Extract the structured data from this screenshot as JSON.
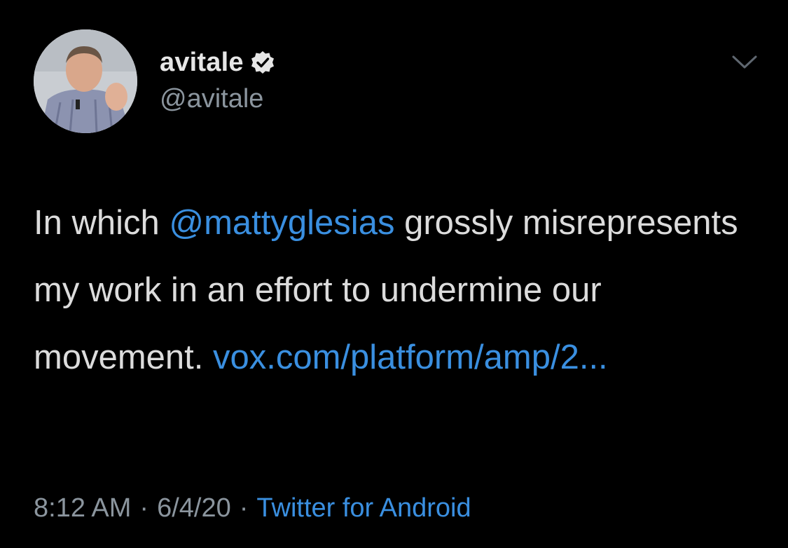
{
  "author": {
    "display_name": "avitale",
    "handle": "@avitale",
    "verified": true
  },
  "tweet": {
    "text_before": "In which ",
    "mention": "@mattyglesias",
    "text_after": " grossly misrepresents my work in an effort to undermine our movement.  ",
    "link_text": "vox.com/platform/amp/2..."
  },
  "meta": {
    "time": "8:12 AM",
    "separator": "·",
    "date": "6/4/20",
    "source": "Twitter for Android"
  },
  "colors": {
    "background": "#000000",
    "link": "#3a8fe0",
    "secondary_text": "#8b959e",
    "primary_text": "#dcdcdc"
  },
  "icons": {
    "verified": "verified-badge-icon",
    "more": "chevron-down-icon"
  }
}
